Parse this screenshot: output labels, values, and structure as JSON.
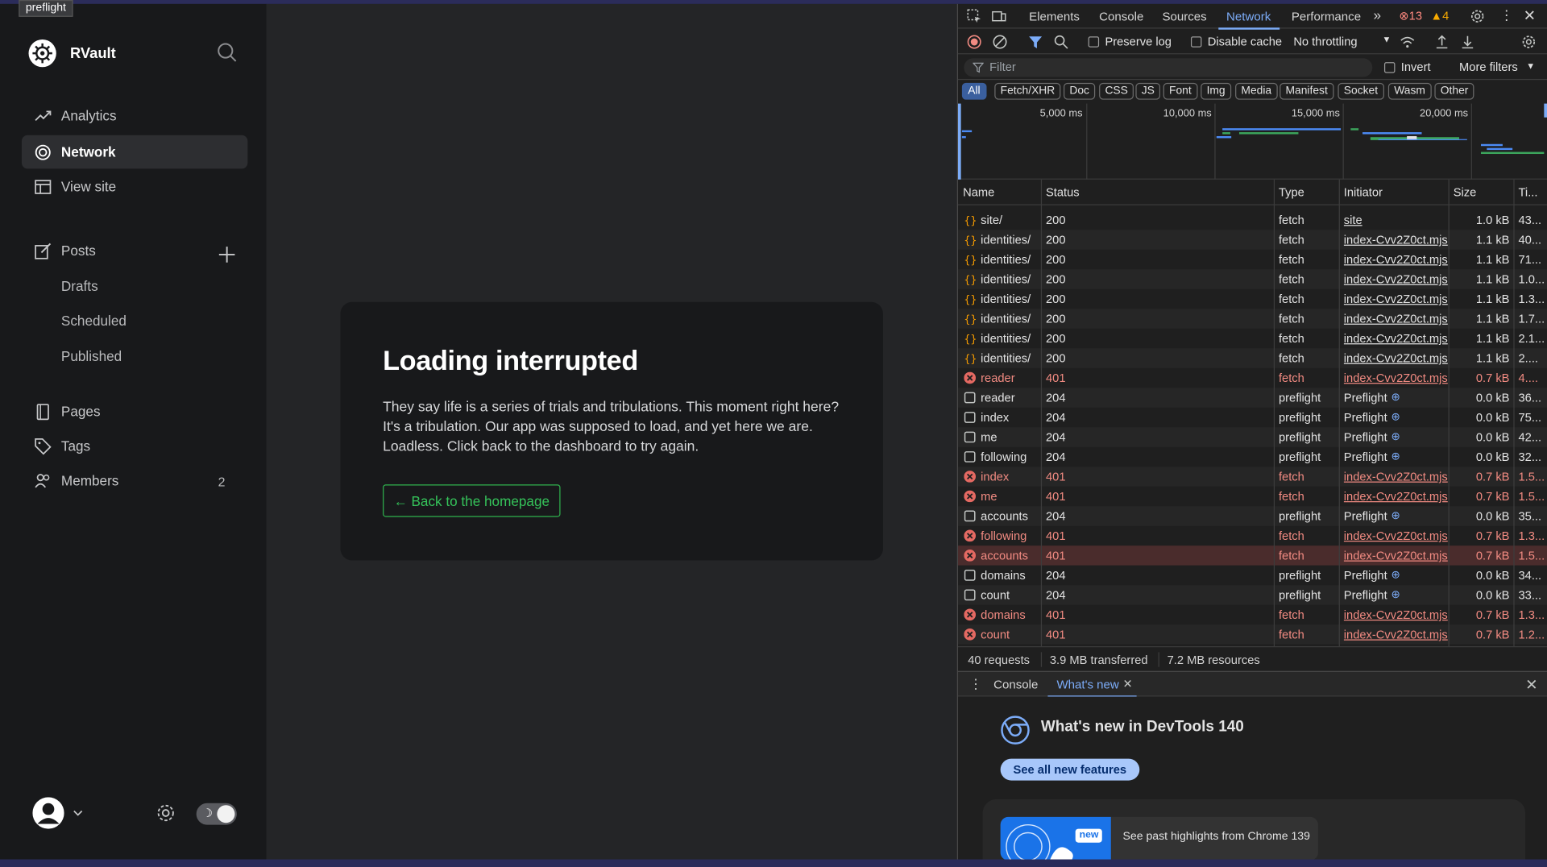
{
  "tooltip": "preflight",
  "sidebar": {
    "brand": "RVault",
    "nav": [
      {
        "label": "Analytics",
        "icon": "analytics-icon"
      },
      {
        "label": "Network",
        "icon": "network-icon",
        "active": true
      },
      {
        "label": "View site",
        "icon": "view-site-icon"
      }
    ],
    "posts_label": "Posts",
    "posts_sub": [
      "Drafts",
      "Scheduled",
      "Published"
    ],
    "pages_label": "Pages",
    "tags_label": "Tags",
    "members_label": "Members",
    "members_count": "2"
  },
  "main": {
    "title": "Loading interrupted",
    "message": "They say life is a series of trials and tribulations. This moment right here? It's a tribulation. Our app was supposed to load, and yet here we are. Loadless. Click back to the dashboard to try again.",
    "back_button": "← Back to the homepage"
  },
  "devtools": {
    "tabs": [
      "Elements",
      "Console",
      "Sources",
      "Network",
      "Performance"
    ],
    "active_tab": "Network",
    "error_count": "13",
    "warning_count": "4",
    "toolbar": {
      "preserve_log": "Preserve log",
      "disable_cache": "Disable cache",
      "throttling": "No throttling"
    },
    "filter_placeholder": "Filter",
    "invert": "Invert",
    "more_filters": "More filters",
    "type_filters": [
      "All",
      "Fetch/XHR",
      "Doc",
      "CSS",
      "JS",
      "Font",
      "Img",
      "Media",
      "Manifest",
      "Socket",
      "Wasm",
      "Other"
    ],
    "timeline_labels": [
      "5,000 ms",
      "10,000 ms",
      "15,000 ms",
      "20,000 ms"
    ],
    "columns": [
      "Name",
      "Status",
      "Type",
      "Initiator",
      "Size",
      "Ti..."
    ],
    "rows": [
      {
        "name": "site/",
        "status": "200",
        "type": "fetch",
        "initiator": "site",
        "size": "1.0 kB",
        "time": "43...",
        "kind": "fetch"
      },
      {
        "name": "identities/",
        "status": "200",
        "type": "fetch",
        "initiator": "index-Cvv2Z0ct.mjs",
        "size": "1.1 kB",
        "time": "40...",
        "kind": "fetch"
      },
      {
        "name": "identities/",
        "status": "200",
        "type": "fetch",
        "initiator": "index-Cvv2Z0ct.mjs",
        "size": "1.1 kB",
        "time": "71...",
        "kind": "fetch"
      },
      {
        "name": "identities/",
        "status": "200",
        "type": "fetch",
        "initiator": "index-Cvv2Z0ct.mjs",
        "size": "1.1 kB",
        "time": "1.0...",
        "kind": "fetch"
      },
      {
        "name": "identities/",
        "status": "200",
        "type": "fetch",
        "initiator": "index-Cvv2Z0ct.mjs",
        "size": "1.1 kB",
        "time": "1.3...",
        "kind": "fetch"
      },
      {
        "name": "identities/",
        "status": "200",
        "type": "fetch",
        "initiator": "index-Cvv2Z0ct.mjs",
        "size": "1.1 kB",
        "time": "1.7...",
        "kind": "fetch"
      },
      {
        "name": "identities/",
        "status": "200",
        "type": "fetch",
        "initiator": "index-Cvv2Z0ct.mjs",
        "size": "1.1 kB",
        "time": "2.1...",
        "kind": "fetch"
      },
      {
        "name": "identities/",
        "status": "200",
        "type": "fetch",
        "initiator": "index-Cvv2Z0ct.mjs",
        "size": "1.1 kB",
        "time": "2....",
        "kind": "fetch"
      },
      {
        "name": "reader",
        "status": "401",
        "type": "fetch",
        "initiator": "index-Cvv2Z0ct.mjs",
        "size": "0.7 kB",
        "time": "4....",
        "kind": "error"
      },
      {
        "name": "reader",
        "status": "204",
        "type": "preflight",
        "initiator": "Preflight",
        "size": "0.0 kB",
        "time": "36...",
        "kind": "preflight"
      },
      {
        "name": "index",
        "status": "204",
        "type": "preflight",
        "initiator": "Preflight",
        "size": "0.0 kB",
        "time": "75...",
        "kind": "preflight"
      },
      {
        "name": "me",
        "status": "204",
        "type": "preflight",
        "initiator": "Preflight",
        "size": "0.0 kB",
        "time": "42...",
        "kind": "preflight"
      },
      {
        "name": "following",
        "status": "204",
        "type": "preflight",
        "initiator": "Preflight",
        "size": "0.0 kB",
        "time": "32...",
        "kind": "preflight"
      },
      {
        "name": "index",
        "status": "401",
        "type": "fetch",
        "initiator": "index-Cvv2Z0ct.mjs",
        "size": "0.7 kB",
        "time": "1.5...",
        "kind": "error"
      },
      {
        "name": "me",
        "status": "401",
        "type": "fetch",
        "initiator": "index-Cvv2Z0ct.mjs",
        "size": "0.7 kB",
        "time": "1.5...",
        "kind": "error"
      },
      {
        "name": "accounts",
        "status": "204",
        "type": "preflight",
        "initiator": "Preflight",
        "size": "0.0 kB",
        "time": "35...",
        "kind": "preflight"
      },
      {
        "name": "following",
        "status": "401",
        "type": "fetch",
        "initiator": "index-Cvv2Z0ct.mjs",
        "size": "0.7 kB",
        "time": "1.3...",
        "kind": "error"
      },
      {
        "name": "accounts",
        "status": "401",
        "type": "fetch",
        "initiator": "index-Cvv2Z0ct.mjs",
        "size": "0.7 kB",
        "time": "1.5...",
        "kind": "error",
        "selected": true
      },
      {
        "name": "domains",
        "status": "204",
        "type": "preflight",
        "initiator": "Preflight",
        "size": "0.0 kB",
        "time": "34...",
        "kind": "preflight"
      },
      {
        "name": "count",
        "status": "204",
        "type": "preflight",
        "initiator": "Preflight",
        "size": "0.0 kB",
        "time": "33...",
        "kind": "preflight"
      },
      {
        "name": "domains",
        "status": "401",
        "type": "fetch",
        "initiator": "index-Cvv2Z0ct.mjs",
        "size": "0.7 kB",
        "time": "1.3...",
        "kind": "error"
      },
      {
        "name": "count",
        "status": "401",
        "type": "fetch",
        "initiator": "index-Cvv2Z0ct.mjs",
        "size": "0.7 kB",
        "time": "1.2...",
        "kind": "error"
      }
    ],
    "status_bar": {
      "requests": "40 requests",
      "transferred": "3.9 MB transferred",
      "resources": "7.2 MB resources"
    },
    "drawer": {
      "tabs": [
        "Console",
        "What's new"
      ],
      "active": "What's new",
      "title": "What's new in DevTools 140",
      "button": "See all new features",
      "badge": "new",
      "highlight": "See past highlights from Chrome 139"
    }
  },
  "colors": {
    "accent_green": "#35c35a",
    "devtools_blue": "#7cacf8",
    "error_red": "#f28b82"
  }
}
